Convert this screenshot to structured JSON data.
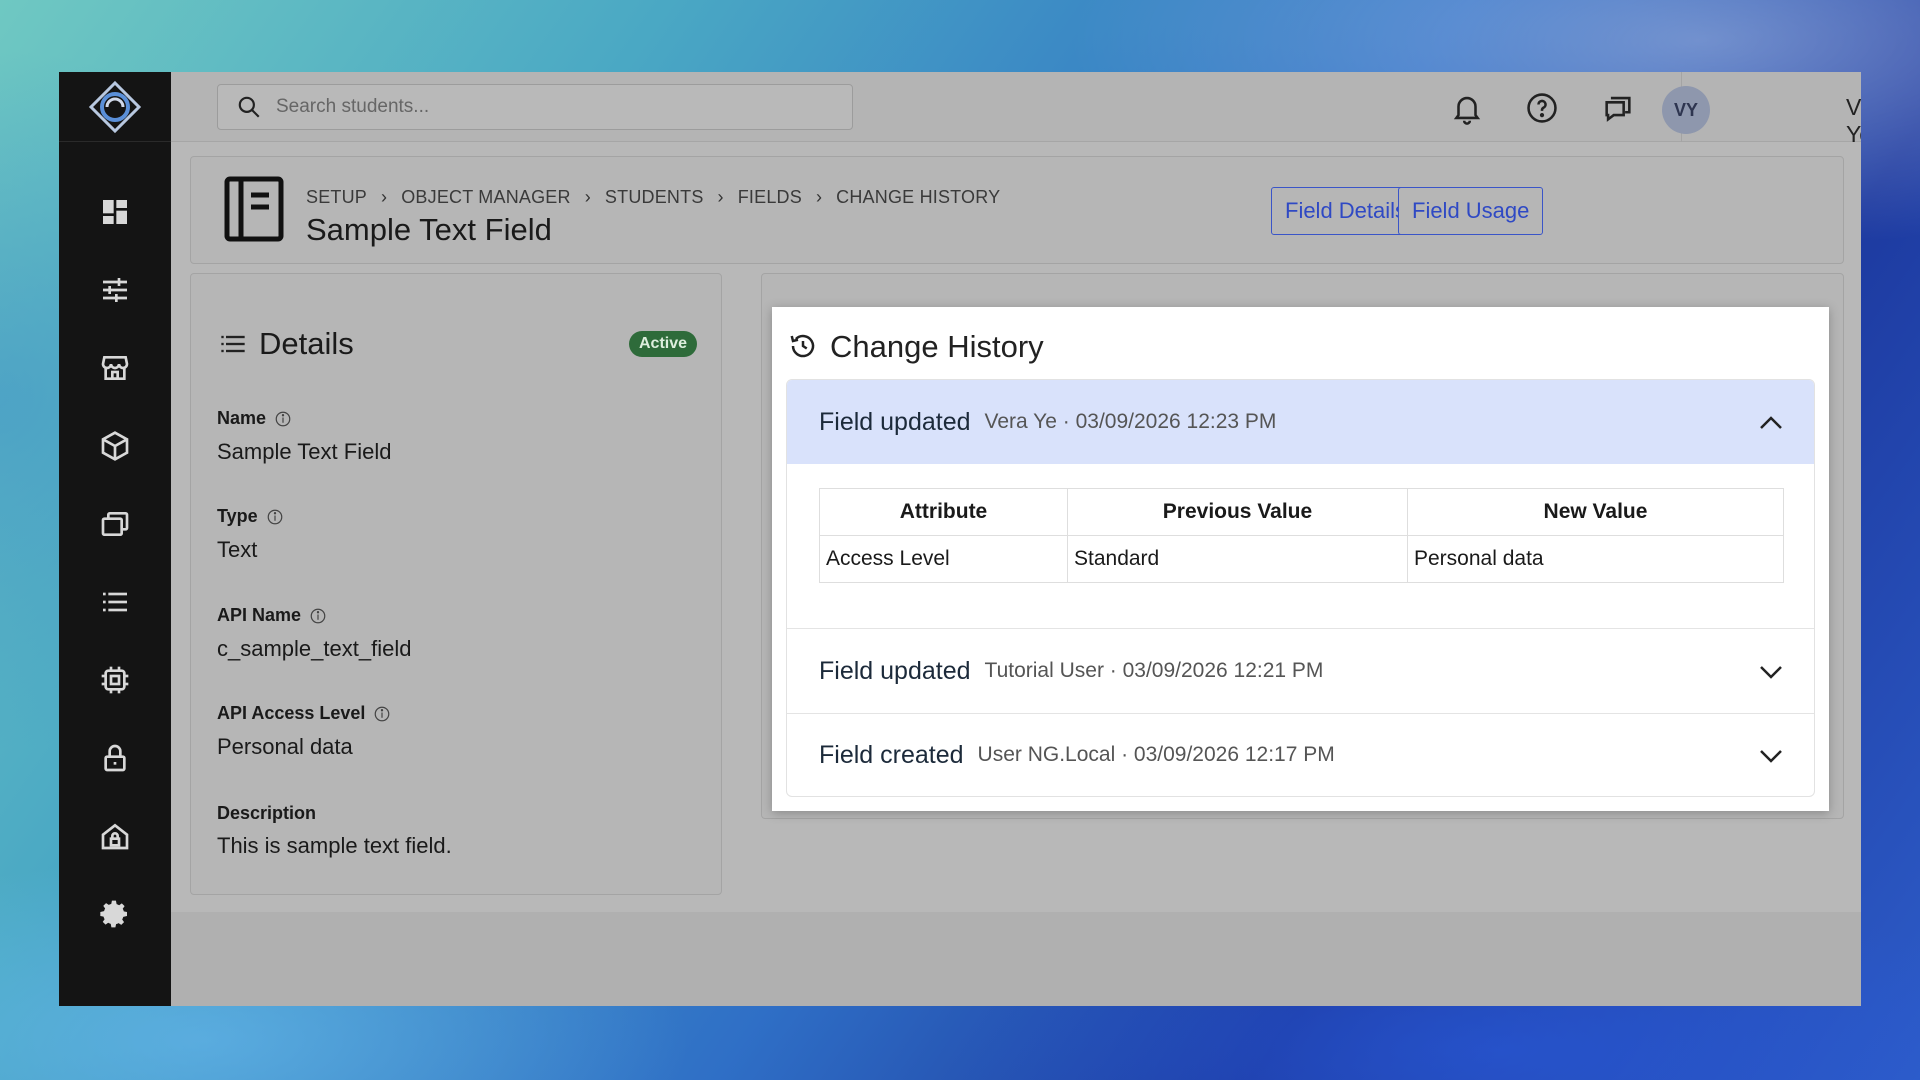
{
  "search": {
    "placeholder": "Search students..."
  },
  "user": {
    "initials": "VY",
    "name": "Vera Ye"
  },
  "sidebar": {
    "items": [
      {
        "icon": "dashboard-icon"
      },
      {
        "icon": "sliders-icon"
      },
      {
        "icon": "store-icon"
      },
      {
        "icon": "cube-icon"
      },
      {
        "icon": "windows-icon"
      },
      {
        "icon": "list-icon"
      },
      {
        "icon": "chip-icon"
      },
      {
        "icon": "lock-icon"
      },
      {
        "icon": "home-lock-icon"
      },
      {
        "icon": "gear-icon"
      }
    ]
  },
  "header": {
    "breadcrumb": [
      "SETUP",
      "OBJECT MANAGER",
      "STUDENTS",
      "FIELDS",
      "CHANGE HISTORY"
    ],
    "title": "Sample Text Field",
    "buttons": {
      "details": "Field Details",
      "usage": "Field Usage"
    }
  },
  "details": {
    "title": "Details",
    "status": "Active",
    "fields": [
      {
        "label": "Name",
        "value": "Sample Text Field"
      },
      {
        "label": "Type",
        "value": "Text"
      },
      {
        "label": "API Name",
        "value": "c_sample_text_field"
      },
      {
        "label": "API Access Level",
        "value": "Personal data"
      },
      {
        "label": "Description",
        "value": "This is sample text field."
      }
    ]
  },
  "history": {
    "title": "Change History",
    "entries": [
      {
        "event": "Field updated",
        "meta": "Vera Ye · 03/09/2026 12:23 PM",
        "expanded": true
      },
      {
        "event": "Field updated",
        "meta": "Tutorial User · 03/09/2026 12:21 PM",
        "expanded": false
      },
      {
        "event": "Field created",
        "meta": "User NG.Local · 03/09/2026 12:17 PM",
        "expanded": false
      }
    ],
    "table": {
      "headers": [
        "Attribute",
        "Previous Value",
        "New Value"
      ],
      "rows": [
        [
          "Access Level",
          "Standard",
          "Personal data"
        ]
      ]
    }
  },
  "colors": {
    "accent": "#2f49c4",
    "badge": "#2e6b3a",
    "expanded_row": "#d9e2fb"
  }
}
